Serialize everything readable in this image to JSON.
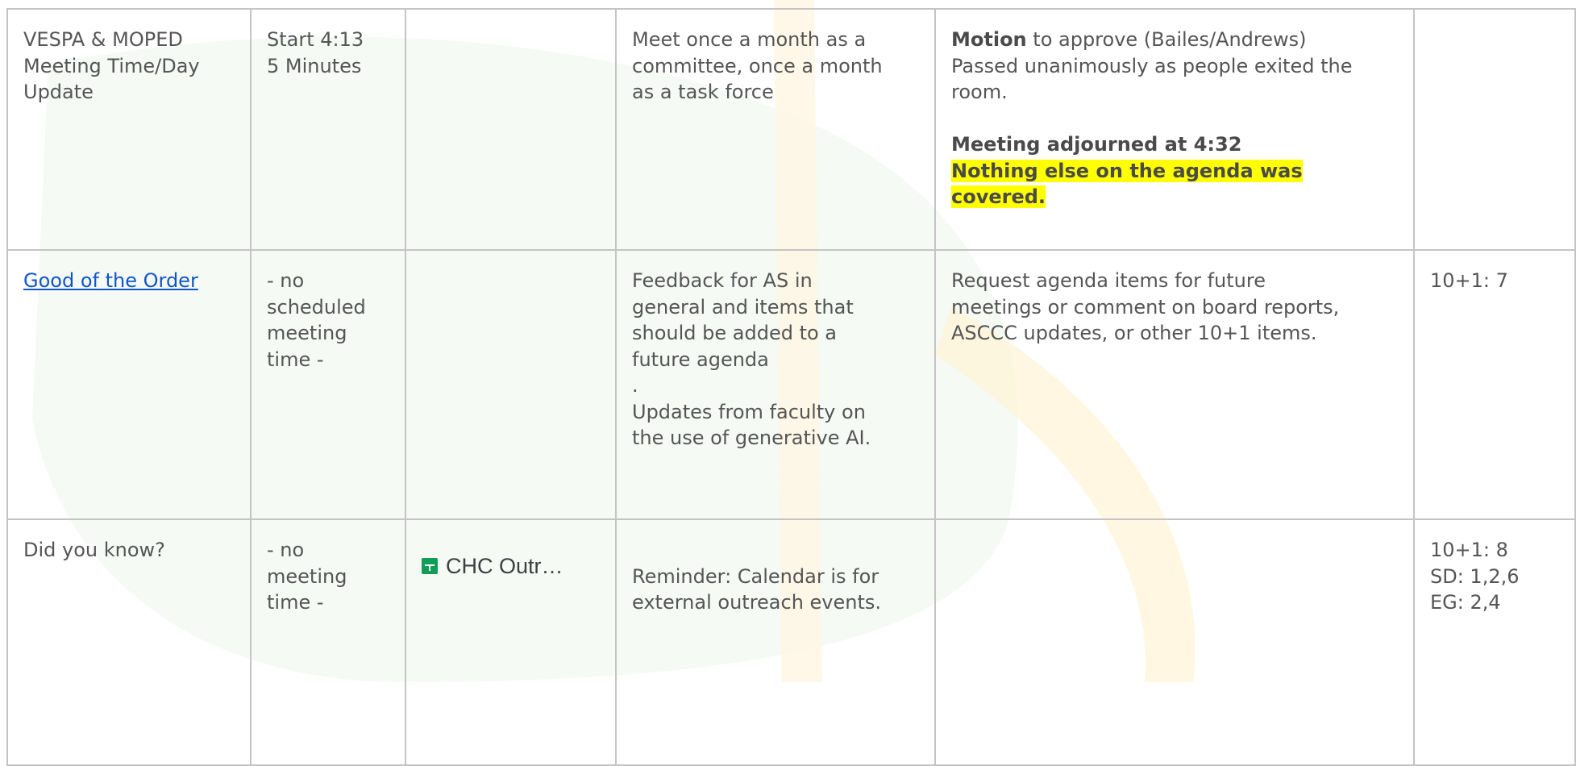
{
  "rows": [
    {
      "topic": [
        "VESPA & MOPED",
        "Meeting Time/Day",
        "Update"
      ],
      "time": [
        "Start 4:13",
        "5 Minutes"
      ],
      "link_chip": "",
      "description": [
        "Meet once a month as a",
        "committee, once a month",
        "as a task force"
      ],
      "notes": {
        "motion_bold": "Motion",
        "motion_rest": " to approve (Bailes/Andrews)",
        "motion_lines": [
          "Passed unanimously as people exited the",
          "room."
        ],
        "adjourned": "Meeting adjourned at 4:32",
        "highlight_lines": [
          "Nothing else on the agenda was",
          "covered."
        ]
      },
      "alignment": []
    },
    {
      "topic_link": "Good of the Order",
      "time": [
        "- no",
        "scheduled",
        "meeting",
        "time -"
      ],
      "description": [
        "Feedback for AS in",
        "general and items that",
        "should be added to a",
        "future agenda",
        ".",
        "Updates from faculty on",
        "the use of generative AI."
      ],
      "notes": [
        "Request agenda items for future",
        "meetings or comment on board reports,",
        "ASCCC updates, or other 10+1 items."
      ],
      "alignment": [
        "10+1: 7"
      ]
    },
    {
      "topic": [
        "Did you know?"
      ],
      "time": [
        "- no",
        "meeting",
        "time -"
      ],
      "link_chip": "CHC Outr…",
      "description": [
        "Reminder: Calendar is for",
        "external outreach events."
      ],
      "notes": [],
      "alignment": [
        "10+1: 8",
        "SD: 1,2,6",
        "EG: 2,4"
      ]
    }
  ],
  "colors": {
    "text": "#555555",
    "link": "#1155cc",
    "highlight": "#ffff00",
    "border": "#c4c4c4",
    "sheets_icon": "#0f9d58"
  },
  "icons": {
    "chip_icon": "google-sheets-icon"
  }
}
